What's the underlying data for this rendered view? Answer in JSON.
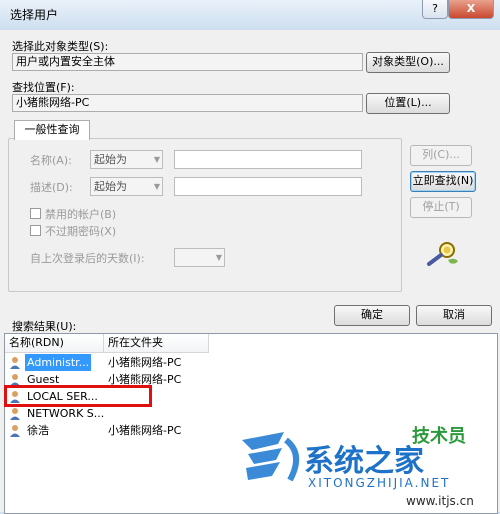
{
  "window": {
    "title": "选择用户",
    "help": "?",
    "close": "X"
  },
  "object_type": {
    "label": "选择此对象类型(S):",
    "value": "用户或内置安全主体",
    "button": "对象类型(O)..."
  },
  "location": {
    "label": "查找位置(F):",
    "value": "小猪熊网络-PC",
    "button": "位置(L)..."
  },
  "query": {
    "tab": "一般性查询",
    "name_label": "名称(A):",
    "name_mode": "起始为",
    "desc_label": "描述(D):",
    "desc_mode": "起始为",
    "disabled_accounts": "禁用的帐户(B)",
    "non_expiring_pwd": "不过期密码(X)",
    "days_since_logon": "自上次登录后的天数(I):"
  },
  "side_buttons": {
    "columns": "列(C)...",
    "find_now": "立即查找(N)",
    "stop": "停止(T)"
  },
  "dialog_buttons": {
    "ok": "确定",
    "cancel": "取消"
  },
  "results": {
    "label": "搜索结果(U):",
    "columns": [
      "名称(RDN)",
      "所在文件夹"
    ],
    "rows": [
      {
        "name": "Administr...",
        "folder": "小猪熊网络-PC",
        "selected": true
      },
      {
        "name": "Guest",
        "folder": "小猪熊网络-PC",
        "selected": false
      },
      {
        "name": "LOCAL SER...",
        "folder": "",
        "selected": false
      },
      {
        "name": "NETWORK S...",
        "folder": "",
        "selected": false
      },
      {
        "name": "徐浩",
        "folder": "小猪熊网络-PC",
        "selected": false
      }
    ]
  },
  "watermark": {
    "brand": "系统之家",
    "site": "XITONGZHIJIA.NET",
    "url": "www.itjs.cn",
    "tech": "技术员"
  },
  "colors": {
    "selection": "#3399ff",
    "highlight_box": "#e01010",
    "title_gradient": "#cddff0"
  }
}
